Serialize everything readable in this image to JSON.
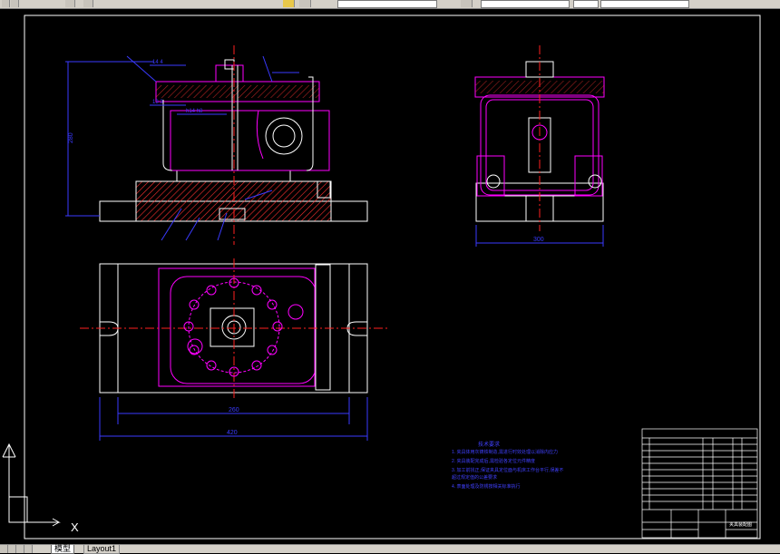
{
  "tabs": {
    "model": "模型",
    "layout1": "Layout1"
  },
  "ucs": {
    "x_label": "X"
  },
  "dimensions": {
    "height_left": "280",
    "width_side": "300",
    "width_inner": "260",
    "width_outer": "420",
    "small_1": "14 4",
    "small_2": "13 3",
    "small_3": "h14 h8"
  },
  "notes": {
    "title": "技术要求",
    "lines": [
      "1. 夹具体用灰铸铁制造,需进行时效处理以消除内应力",
      "2. 夹具装配完成后,需检验各定位元件精度",
      "3. 加工前找正,保证夹具定位面与机床工作台平行,误差不",
      "   超过规定值的公差要求",
      "4. 表面处理及防锈按相关标准执行"
    ]
  },
  "title_block": {
    "drawing_name": "夹具装配图"
  },
  "colors": {
    "background": "#000000",
    "outline": "#ffffff",
    "part": "#ff00ff",
    "dimension": "#3a3aff",
    "hatch": "#ff3030",
    "center": "#ff2020",
    "notes": "#4040ff"
  }
}
